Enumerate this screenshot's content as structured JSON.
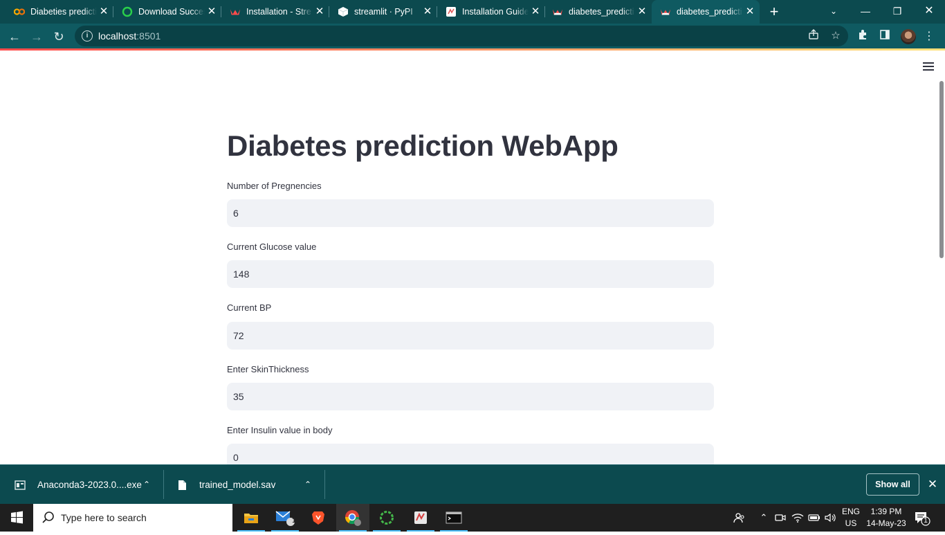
{
  "browser": {
    "tabs": [
      {
        "title": "Diabeties predicti",
        "favicon": "colab-icon",
        "color": "#f9ab00"
      },
      {
        "title": "Download Succes",
        "favicon": "download-success-icon",
        "color": "#2ad04a"
      },
      {
        "title": "Installation - Stre",
        "favicon": "streamlit-crown-icon",
        "color": "#ff4b4b"
      },
      {
        "title": "streamlit · PyPI",
        "favicon": "pypi-cube-icon",
        "color": "#ffffff"
      },
      {
        "title": "Installation Guide",
        "favicon": "anaconda-docs-icon",
        "color": "#e05a5a"
      },
      {
        "title": "diabetes_predicti",
        "favicon": "streamlit-crown-icon",
        "color": "#ff4b4b"
      },
      {
        "title": "diabetes_predicti",
        "favicon": "streamlit-crown-icon",
        "color": "#ff4b4b",
        "active": true
      }
    ],
    "url_host": "localhost",
    "url_port": ":8501"
  },
  "app": {
    "title": "Diabetes prediction WebApp",
    "fields": [
      {
        "label": "Number of Pregnencies",
        "value": "6"
      },
      {
        "label": "Current Glucose value",
        "value": "148"
      },
      {
        "label": "Current BP",
        "value": "72"
      },
      {
        "label": "Enter SkinThickness",
        "value": "35"
      },
      {
        "label": "Enter Insulin value in body",
        "value": "0"
      }
    ]
  },
  "downloads": {
    "items": [
      {
        "name": "Anaconda3-2023.0....exe",
        "icon": "installer-icon"
      },
      {
        "name": "trained_model.sav",
        "icon": "file-icon"
      }
    ],
    "show_all_label": "Show all"
  },
  "taskbar": {
    "search_placeholder": "Type here to search",
    "mail_badge": "1",
    "lang_line1": "ENG",
    "lang_line2": "US",
    "time": "1:39 PM",
    "date": "14-May-23",
    "notification_count": "1"
  },
  "colors": {
    "browser_frame": "#0c4a4f",
    "toolbar": "#0f5a61",
    "input_bg": "#f0f2f6",
    "text": "#31333f",
    "accent_gradient_start": "#ff4b4b"
  }
}
